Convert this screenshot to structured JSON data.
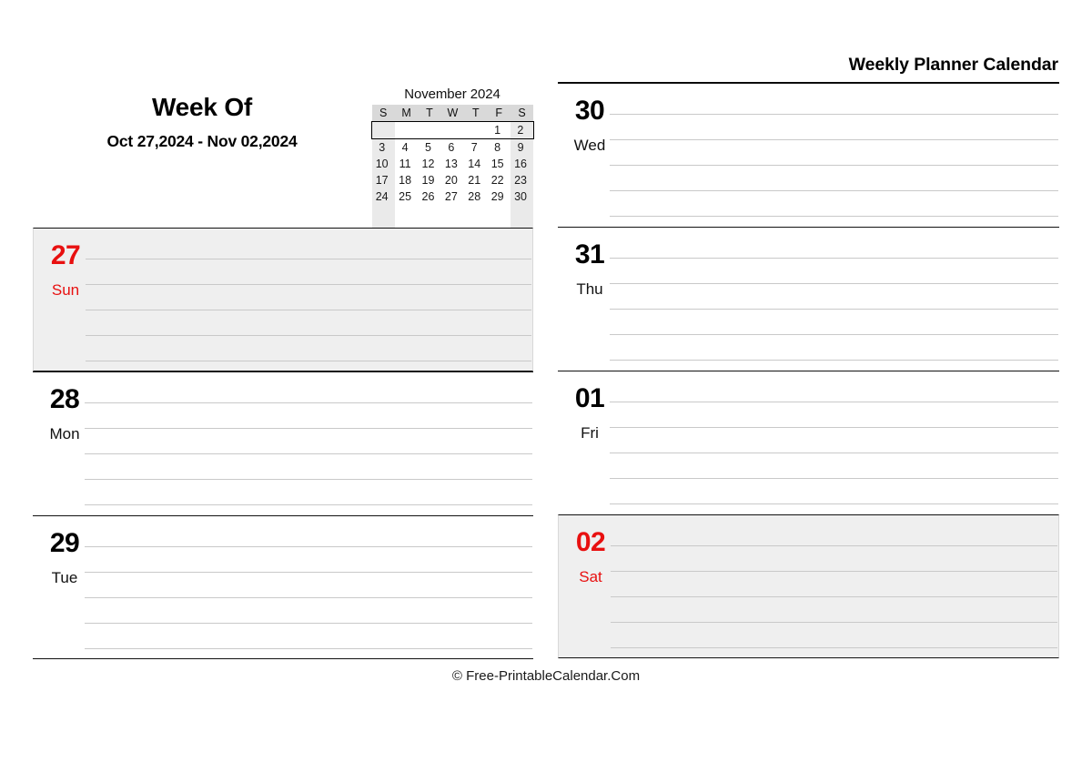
{
  "header": {
    "planner_title": "Weekly Planner Calendar",
    "week_of_label": "Week Of",
    "week_range": "Oct 27,2024 - Nov 02,2024"
  },
  "mini_calendar": {
    "title": "November 2024",
    "weekday_headers": [
      "S",
      "M",
      "T",
      "W",
      "T",
      "F",
      "S"
    ],
    "weeks": [
      [
        {
          "label": "",
          "blank": true,
          "red": false,
          "weekend": true
        },
        {
          "label": "",
          "blank": true,
          "red": false,
          "weekend": false
        },
        {
          "label": "",
          "blank": true,
          "red": false,
          "weekend": false
        },
        {
          "label": "",
          "blank": true,
          "red": false,
          "weekend": false
        },
        {
          "label": "",
          "blank": true,
          "red": false,
          "weekend": false
        },
        {
          "label": "1",
          "blank": false,
          "red": false,
          "weekend": false
        },
        {
          "label": "2",
          "blank": false,
          "red": true,
          "weekend": true
        }
      ],
      [
        {
          "label": "3",
          "blank": false,
          "red": true,
          "weekend": true
        },
        {
          "label": "4",
          "blank": false,
          "red": false,
          "weekend": false
        },
        {
          "label": "5",
          "blank": false,
          "red": false,
          "weekend": false
        },
        {
          "label": "6",
          "blank": false,
          "red": false,
          "weekend": false
        },
        {
          "label": "7",
          "blank": false,
          "red": false,
          "weekend": false
        },
        {
          "label": "8",
          "blank": false,
          "red": false,
          "weekend": false
        },
        {
          "label": "9",
          "blank": false,
          "red": true,
          "weekend": true
        }
      ],
      [
        {
          "label": "10",
          "blank": false,
          "red": true,
          "weekend": true
        },
        {
          "label": "11",
          "blank": false,
          "red": true,
          "weekend": false
        },
        {
          "label": "12",
          "blank": false,
          "red": false,
          "weekend": false
        },
        {
          "label": "13",
          "blank": false,
          "red": false,
          "weekend": false
        },
        {
          "label": "14",
          "blank": false,
          "red": false,
          "weekend": false
        },
        {
          "label": "15",
          "blank": false,
          "red": false,
          "weekend": false
        },
        {
          "label": "16",
          "blank": false,
          "red": true,
          "weekend": true
        }
      ],
      [
        {
          "label": "17",
          "blank": false,
          "red": true,
          "weekend": true
        },
        {
          "label": "18",
          "blank": false,
          "red": false,
          "weekend": false
        },
        {
          "label": "19",
          "blank": false,
          "red": false,
          "weekend": false
        },
        {
          "label": "20",
          "blank": false,
          "red": false,
          "weekend": false
        },
        {
          "label": "21",
          "blank": false,
          "red": false,
          "weekend": false
        },
        {
          "label": "22",
          "blank": false,
          "red": false,
          "weekend": false
        },
        {
          "label": "23",
          "blank": false,
          "red": true,
          "weekend": true
        }
      ],
      [
        {
          "label": "24",
          "blank": false,
          "red": true,
          "weekend": true
        },
        {
          "label": "25",
          "blank": false,
          "red": false,
          "weekend": false
        },
        {
          "label": "26",
          "blank": false,
          "red": false,
          "weekend": false
        },
        {
          "label": "27",
          "blank": false,
          "red": false,
          "weekend": false
        },
        {
          "label": "28",
          "blank": false,
          "red": true,
          "weekend": false
        },
        {
          "label": "29",
          "blank": false,
          "red": false,
          "weekend": false
        },
        {
          "label": "30",
          "blank": false,
          "red": true,
          "weekend": true
        }
      ],
      [
        {
          "label": "",
          "blank": true,
          "red": false,
          "weekend": true
        },
        {
          "label": "",
          "blank": true,
          "red": false,
          "weekend": false
        },
        {
          "label": "",
          "blank": true,
          "red": false,
          "weekend": false
        },
        {
          "label": "",
          "blank": true,
          "red": false,
          "weekend": false
        },
        {
          "label": "",
          "blank": true,
          "red": false,
          "weekend": false
        },
        {
          "label": "",
          "blank": true,
          "red": false,
          "weekend": false
        },
        {
          "label": "",
          "blank": true,
          "red": false,
          "weekend": true
        }
      ]
    ],
    "highlighted_week_index": 0
  },
  "days_left": [
    {
      "number": "27",
      "name": "Sun",
      "weekend": true
    },
    {
      "number": "28",
      "name": "Mon",
      "weekend": false
    },
    {
      "number": "29",
      "name": "Tue",
      "weekend": false
    }
  ],
  "days_right": [
    {
      "number": "30",
      "name": "Wed",
      "weekend": false
    },
    {
      "number": "31",
      "name": "Thu",
      "weekend": false
    },
    {
      "number": "01",
      "name": "Fri",
      "weekend": false
    },
    {
      "number": "02",
      "name": "Sat",
      "weekend": true
    }
  ],
  "footer": {
    "copyright": "© Free-PrintableCalendar.Com"
  },
  "colors": {
    "weekend_red": "#e81010",
    "weekend_bg": "#efefef",
    "mini_header_bg": "#d9d9d9",
    "mini_weekend_bg": "#eaeaea",
    "rule_line": "#c9c9c9",
    "border_dark": "#111111"
  },
  "rules_per_day": 5
}
